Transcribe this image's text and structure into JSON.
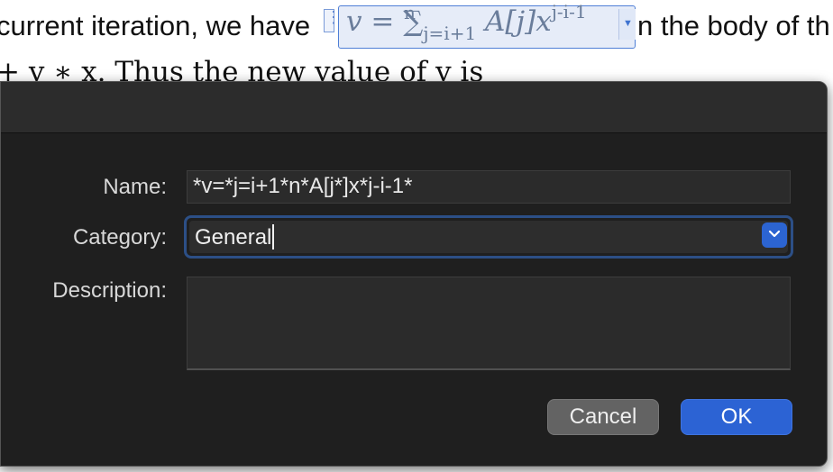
{
  "document": {
    "line1_before": "current iteration, we have",
    "equation": {
      "lhs": "v = ",
      "sum_symbol": "∑",
      "sum_upper": "n",
      "sum_lower": "j=i+1",
      "body": " A[j]x",
      "exponent": "j-i-1"
    },
    "line1_after": "n the body of th",
    "line2": "+ v ∗ x. Thus the new value of v is"
  },
  "dialog": {
    "labels": {
      "name": "Name:",
      "category": "Category:",
      "description": "Description:"
    },
    "fields": {
      "name_value": "*v=*j=i+1*n*A[j*]x*j-i-1*",
      "category_value": "General",
      "description_value": ""
    },
    "buttons": {
      "cancel": "Cancel",
      "ok": "OK"
    },
    "colors": {
      "accent": "#2c63d4",
      "background": "#1f1f1f",
      "focus_ring": "#2c4f86"
    }
  }
}
